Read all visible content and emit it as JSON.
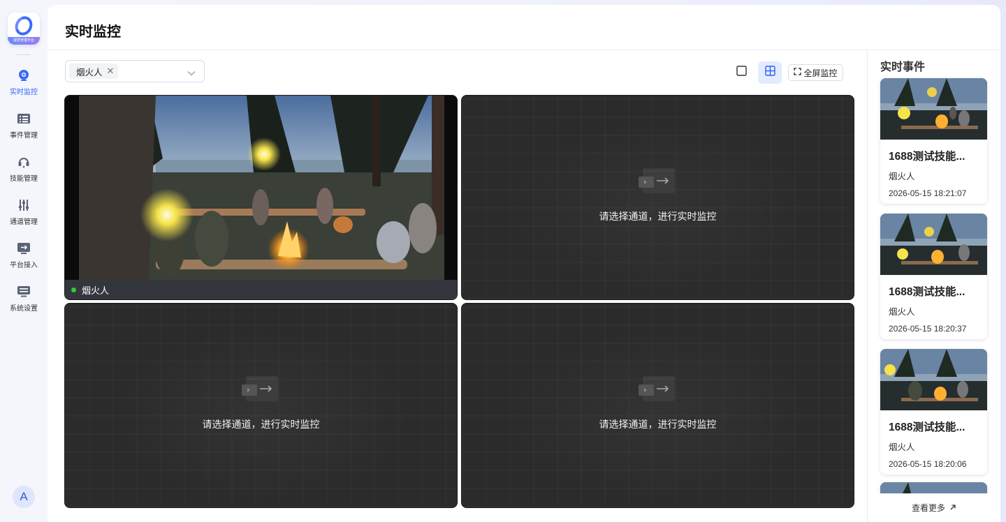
{
  "app": {
    "logo_caption": "视觉管理平台",
    "avatar_initial": "A"
  },
  "sidebar": {
    "items": [
      {
        "label": "实时监控",
        "icon": "monitor-camera-icon",
        "active": true
      },
      {
        "label": "事件管理",
        "icon": "event-list-icon",
        "active": false
      },
      {
        "label": "技能管理",
        "icon": "headset-icon",
        "active": false
      },
      {
        "label": "通道管理",
        "icon": "sliders-icon",
        "active": false
      },
      {
        "label": "平台接入",
        "icon": "access-arrow-icon",
        "active": false
      },
      {
        "label": "系统设置",
        "icon": "settings-panel-icon",
        "active": false
      }
    ]
  },
  "header": {
    "title": "实时监控"
  },
  "toolbar": {
    "selected_tag": "烟火人",
    "single_layout_icon": "single-view-icon",
    "quad_layout_icon": "quad-view-icon",
    "fullscreen_label": "全屏监控"
  },
  "grid": {
    "tiles": [
      {
        "state": "live",
        "channel_name": "烟火人"
      },
      {
        "state": "empty",
        "placeholder": "请选择通道，进行实时监控"
      },
      {
        "state": "empty",
        "placeholder": "请选择通道，进行实时监控"
      },
      {
        "state": "empty",
        "placeholder": "请选择通道，进行实时监控"
      }
    ]
  },
  "events": {
    "title": "实时事件",
    "items": [
      {
        "title": "1688测试技能...",
        "skill": "烟火人",
        "time": "2026-05-15 18:21:07"
      },
      {
        "title": "1688测试技能...",
        "skill": "烟火人",
        "time": "2026-05-15 18:20:37"
      },
      {
        "title": "1688测试技能...",
        "skill": "烟火人",
        "time": "2026-05-15 18:20:06"
      }
    ],
    "more_label": "查看更多"
  },
  "colors": {
    "accent": "#2f5ff5",
    "live_dot": "#2ecc40",
    "tile_bg": "#2b2b2b"
  }
}
